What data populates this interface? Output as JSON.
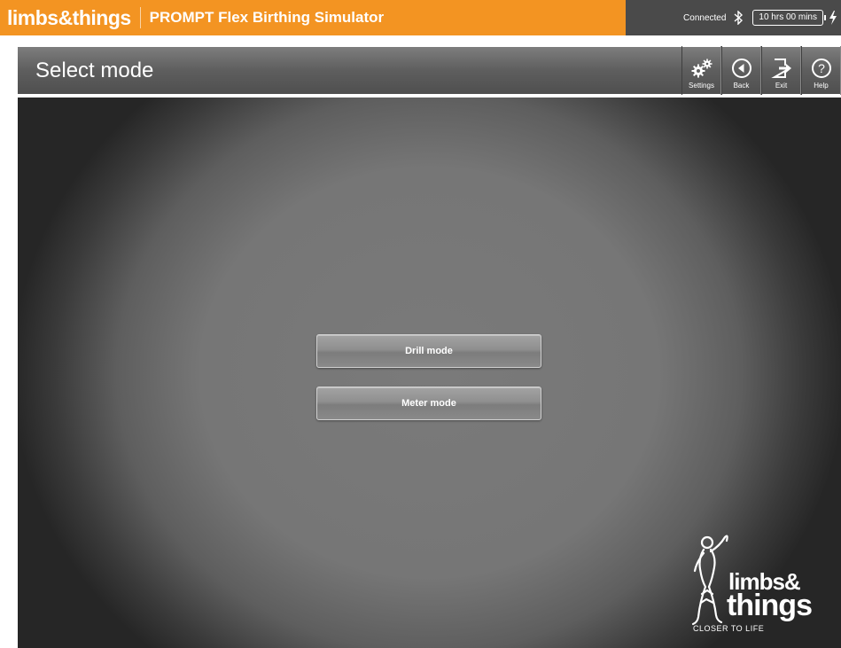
{
  "topbar": {
    "brand": "limbs&things",
    "title": "PROMPT Flex Birthing Simulator",
    "status": "Connected",
    "battery": "10 hrs 00 mins",
    "icons": [
      "bluetooth-icon",
      "charging-icon"
    ]
  },
  "header": {
    "title": "Select mode",
    "buttons": [
      {
        "label": "Settings",
        "icon": "gear-icon"
      },
      {
        "label": "Back",
        "icon": "back-icon"
      },
      {
        "label": "Exit",
        "icon": "exit-icon"
      },
      {
        "label": "Help",
        "icon": "help-icon"
      }
    ]
  },
  "main": {
    "modes": [
      {
        "label": "Drill mode"
      },
      {
        "label": "Meter mode"
      }
    ]
  },
  "logo": {
    "line1": "limbs&",
    "line2": "things",
    "tagline": "CLOSER TO LIFE"
  },
  "colors": {
    "brand_orange": "#f39422",
    "status_bar": "#4a4a4a",
    "header_gray": "#5e5e5e"
  }
}
